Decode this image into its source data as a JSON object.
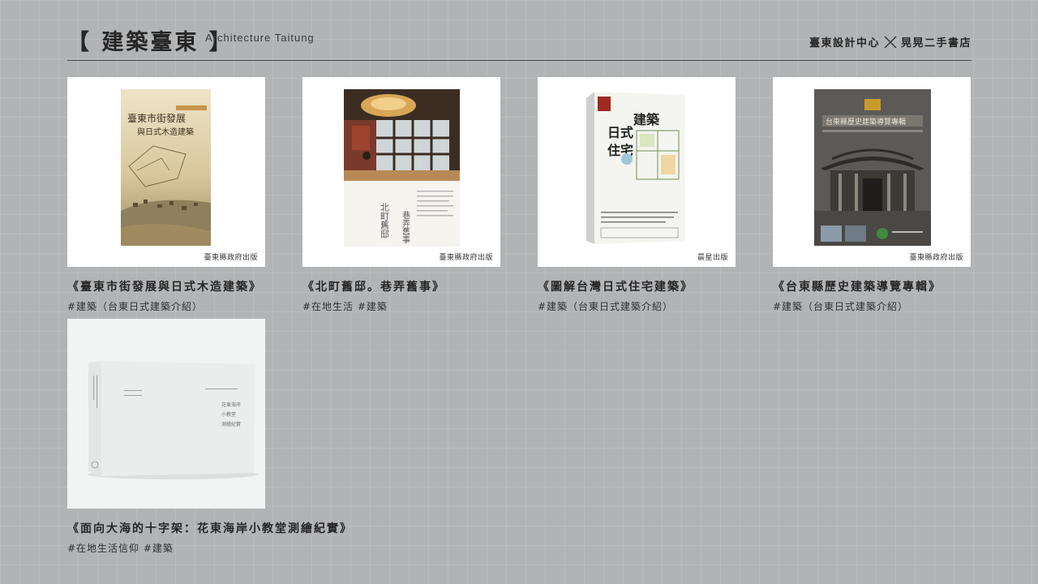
{
  "header": {
    "title": "【 建築臺東 】",
    "subtitle": "Architecture Taitung",
    "partner_left": "臺東設計中心",
    "partner_right": "晃晃二手書店",
    "separator_icon": "cross-icon"
  },
  "books": [
    {
      "title": "《臺東市街發展與日式木造建築》",
      "tags": "#建築（台東日式建築介紹）",
      "publisher": "臺東縣政府出版",
      "cover_icon": "book-cover-map-illustration"
    },
    {
      "title": "《北町舊邸。巷弄舊事》",
      "tags": "#在地生活 #建築",
      "publisher": "臺東縣政府出版",
      "cover_icon": "book-cover-window-photo"
    },
    {
      "title": "《圖解台灣日式住宅建築》",
      "tags": "#建築（台東日式建築介紹）",
      "publisher": "晨星出版",
      "cover_icon": "book-cover-floorplan"
    },
    {
      "title": "《台東縣歷史建築導覽專輯》",
      "tags": "#建築（台東日式建築介紹）",
      "publisher": "臺東縣政府出版",
      "cover_icon": "book-cover-temple-photo"
    },
    {
      "title": "《面向大海的十字架：花東海岸小教堂測繪紀實》",
      "tags": "#在地生活信仰 #建築",
      "publisher": "",
      "cover_icon": "book-cover-white-box"
    }
  ]
}
